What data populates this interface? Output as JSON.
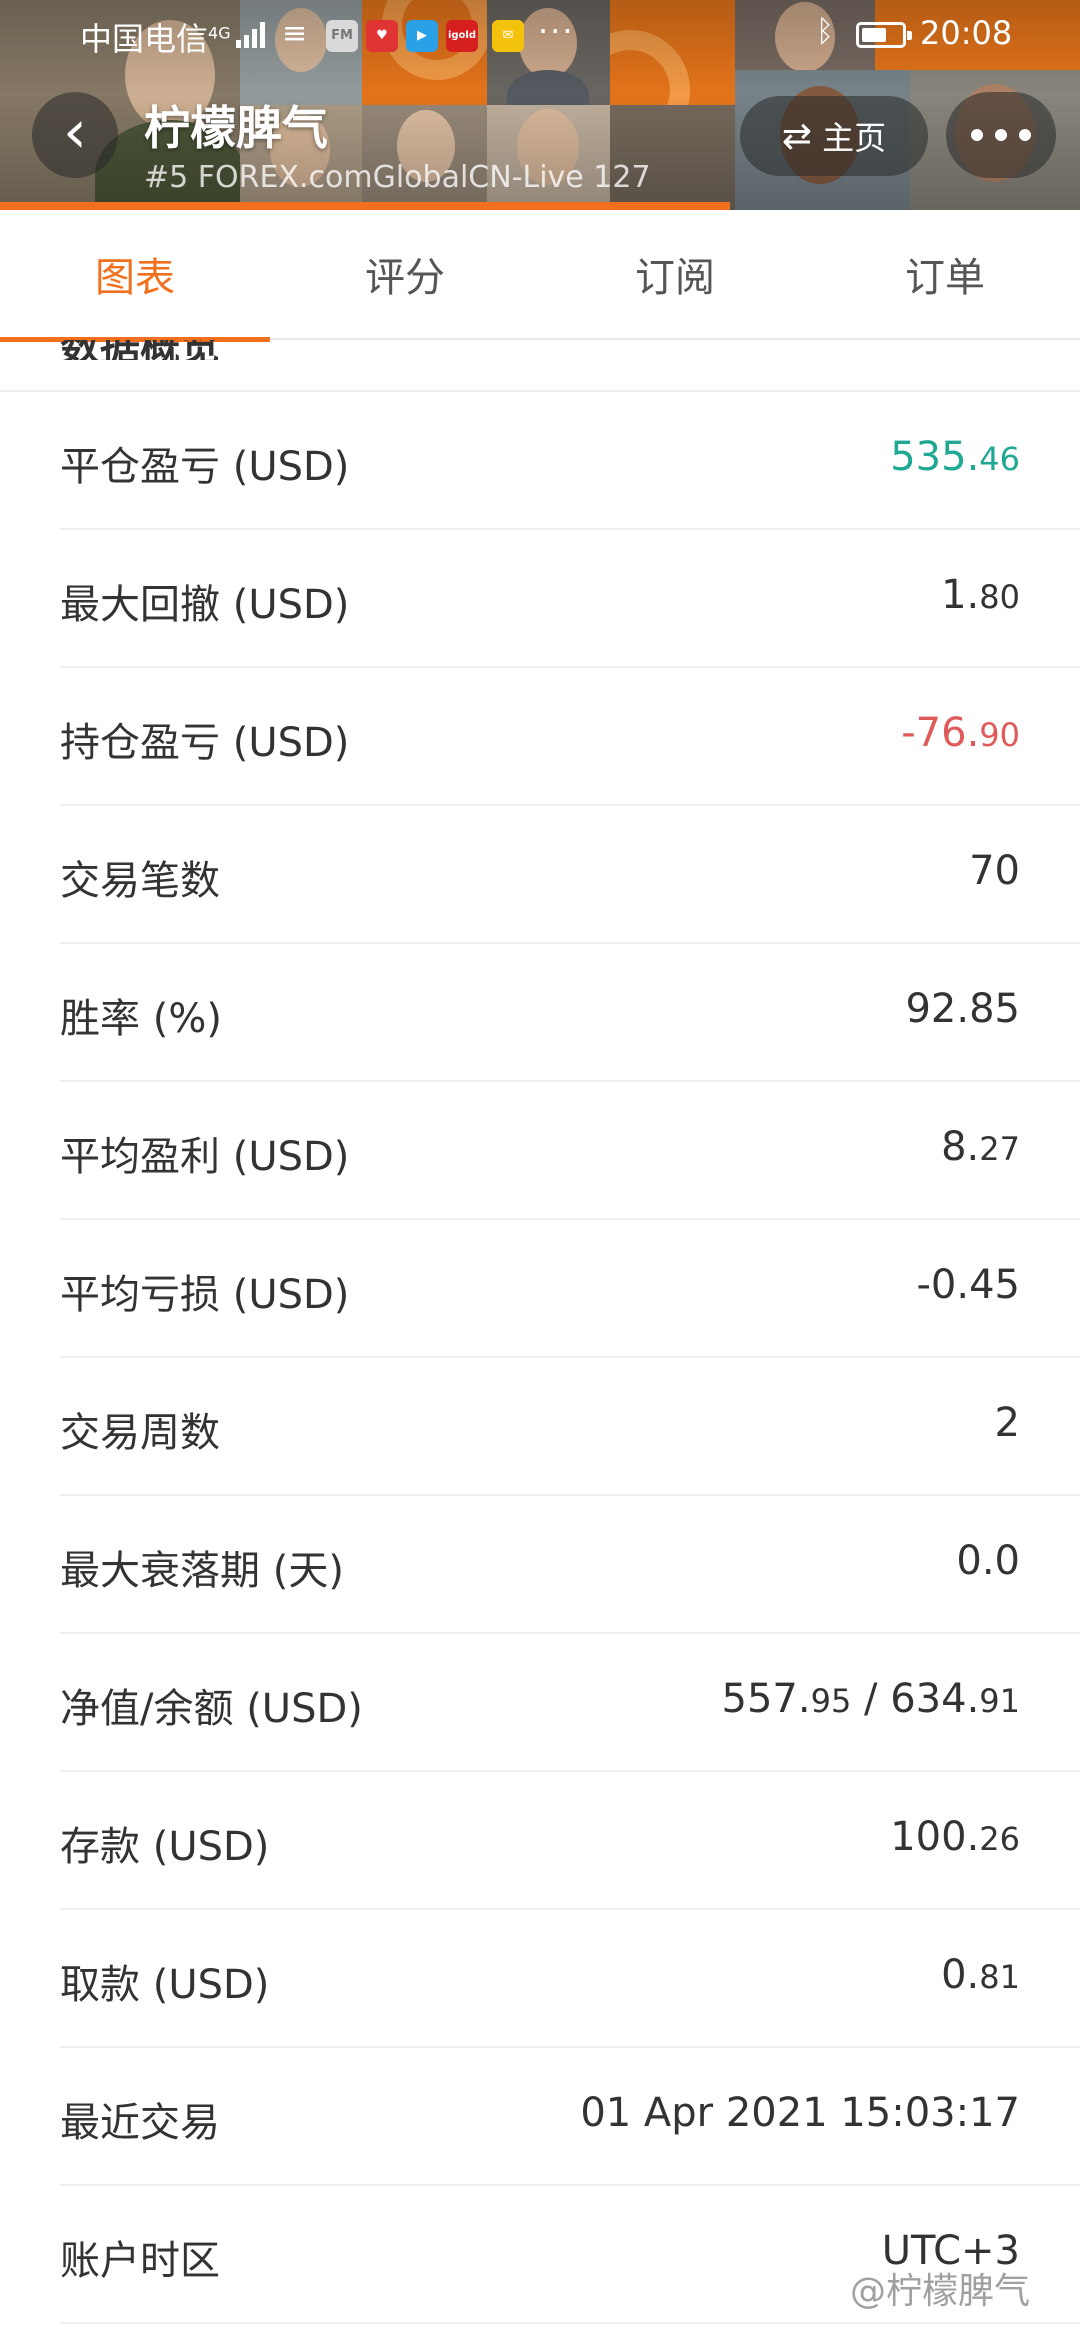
{
  "status_bar": {
    "carrier": "中国电信",
    "network": "4G",
    "notif_fm": "FM",
    "notif_igold": "igold",
    "overflow": "···",
    "time": "20:08"
  },
  "header": {
    "title": "柠檬脾气",
    "subtitle": "#5   FOREX.comGlobalCN-Live 127",
    "home_label": "主页"
  },
  "tabs": [
    "图表",
    "评分",
    "订阅",
    "订单"
  ],
  "section_title": "数据概览",
  "rows": [
    {
      "label": "平仓盈亏 (USD)",
      "int": "535.",
      "dec": "46"
    },
    {
      "label": "最大回撤 (USD)",
      "int": "1.",
      "dec": "80"
    },
    {
      "label": "持仓盈亏 (USD)",
      "int": "-76.",
      "dec": "90"
    },
    {
      "label": "交易笔数",
      "int": "70",
      "dec": ""
    },
    {
      "label": "胜率 (%)",
      "int": "92.85",
      "dec": ""
    },
    {
      "label": "平均盈利 (USD)",
      "int": "8.",
      "dec": "27"
    },
    {
      "label": "平均亏损 (USD)",
      "int": "-0.45",
      "dec": ""
    },
    {
      "label": "交易周数",
      "int": "2",
      "dec": ""
    },
    {
      "label": "最大衰落期 (天)",
      "int": "0.0",
      "dec": ""
    },
    {
      "label": "净值/余额 (USD)",
      "int": "557.",
      "dec": "95",
      "int2": " / 634.",
      "dec2": "91"
    },
    {
      "label": "存款 (USD)",
      "int": "100.",
      "dec": "26"
    },
    {
      "label": "取款 (USD)",
      "int": "0.",
      "dec": "81"
    },
    {
      "label": "最近交易",
      "int": "01 Apr 2021 15:03:17",
      "dec": ""
    },
    {
      "label": "账户时区",
      "int": "UTC+3",
      "dec": ""
    }
  ],
  "colors": {
    "accent": "#f0701e",
    "positive": "#20a894",
    "negative": "#e05a5a"
  },
  "watermark": "@柠檬脾气"
}
